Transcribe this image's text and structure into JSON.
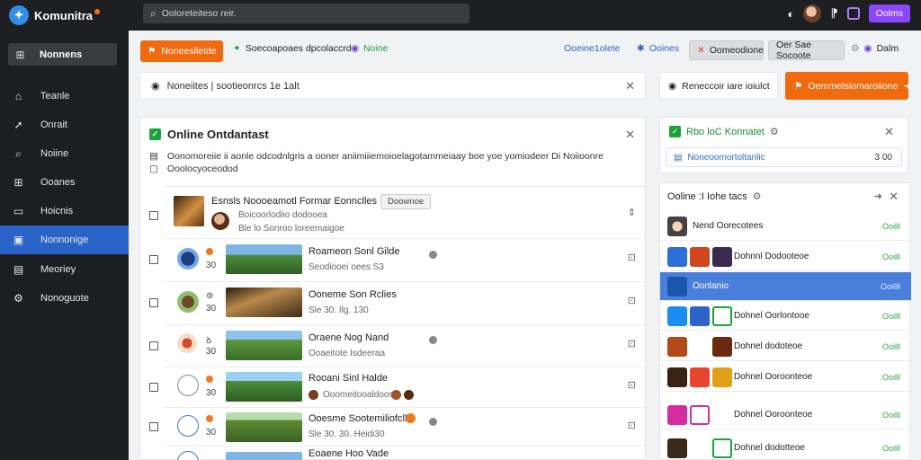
{
  "app": {
    "title": "Komunitra"
  },
  "search": {
    "placeholder": "Ooloreteiteso reir."
  },
  "topbar": {
    "button_label": "Oolms"
  },
  "sidebar": {
    "header_label": "Nonnens",
    "items": [
      {
        "label": "Teanle",
        "icon": "home-icon"
      },
      {
        "label": "Onrait",
        "icon": "share-icon"
      },
      {
        "label": "Noiine",
        "icon": "search-icon"
      },
      {
        "label": "Ooanes",
        "icon": "grid-icon"
      },
      {
        "label": "Hoicnis",
        "icon": "image-icon"
      },
      {
        "label": "Nonnonige",
        "icon": "gallery-icon",
        "active": true
      },
      {
        "label": "Meoriey",
        "icon": "lock-icon"
      },
      {
        "label": "Nonoguote",
        "icon": "gear-icon"
      }
    ]
  },
  "toolbar": {
    "primary_label": "Noneeslletde",
    "link1": "Soecoapoaes dpcolaccrd",
    "link2": "Noine",
    "link3": "Ooeine1olete",
    "link4": "Ooines",
    "gray1": "Oomeodione",
    "gray2": "Oer Sae Socoote",
    "link5": "Dalm"
  },
  "filter": {
    "text": "Noneiites | sootieonrcs 1e 1alt"
  },
  "right_buttons": {
    "outline_label": "Reneccoir iare ioiulct",
    "orange_label": "Oemmetsiomaroiione"
  },
  "main_panel": {
    "title": "Online Ontdantast",
    "line1": "Oonomoreiie ii aonle odcodnlgris a ooner aniimiiiemoioelagotammeiaay   boe yoe yomiodeer Di Noiioonre",
    "line2": "Ooolocyoceodod",
    "rows": [
      {
        "title": "Esnsls Noooeamotl Formar Eonnclles",
        "sub": "Boicoorlodiio dodooea",
        "sub2": "Ble lo Sonroo loreemaigoe",
        "tag": "Doownoe"
      },
      {
        "title": "Roameon Sonl Gilde",
        "sub": "Seodiooei oees S3",
        "num": "30"
      },
      {
        "title": "Ooneme Son Rclies",
        "sub": "Sle 30. Ilg. 130",
        "num": "30"
      },
      {
        "title": "Oraene Nog Nand",
        "sub": "Ooaeitote Isdeeraa",
        "num": "30"
      },
      {
        "title": "Rooani Sinl Halde",
        "sub": "Ooomeitooaldoos",
        "num": "30"
      },
      {
        "title": "Ooesme Sootemiliofcllis",
        "sub": "Sle 30. 30. Heidi30",
        "num": "30"
      },
      {
        "title": "Eoaene Hoo Vade",
        "sub": "",
        "num": "30"
      }
    ]
  },
  "right_panel_1": {
    "title": "Rbo loC Konnatet",
    "inner": "Noneoomortoltarilic",
    "inner_right": "3 00"
  },
  "right_panel_2": {
    "title": "Ooline :I Iohe tacs",
    "rows": [
      {
        "label": "Nend Oorecotees",
        "val": "Ooilll"
      },
      {
        "label": "Dohnnl Dodooteoe",
        "val": "Ooilll"
      },
      {
        "label": "Oonlanio",
        "val": "Ooillll",
        "selected": true
      },
      {
        "label": "Dohnel Oorlontooe",
        "val": "Ooilll"
      },
      {
        "label": "Dohnel dodoteoe",
        "val": "Ooilll"
      },
      {
        "label": "Dohnel Ooroonteoe",
        "val": "Ooilll"
      },
      {
        "label": "Dohnel Ooroonteoe",
        "val": "Ooilll"
      },
      {
        "label": "Dohnel dodotteoe",
        "val": "Ooilll"
      }
    ]
  },
  "colors": {
    "accent": "#f06a10",
    "primary_blue": "#2a64c8",
    "purple": "#8b46ff",
    "green": "#1aa33a"
  }
}
